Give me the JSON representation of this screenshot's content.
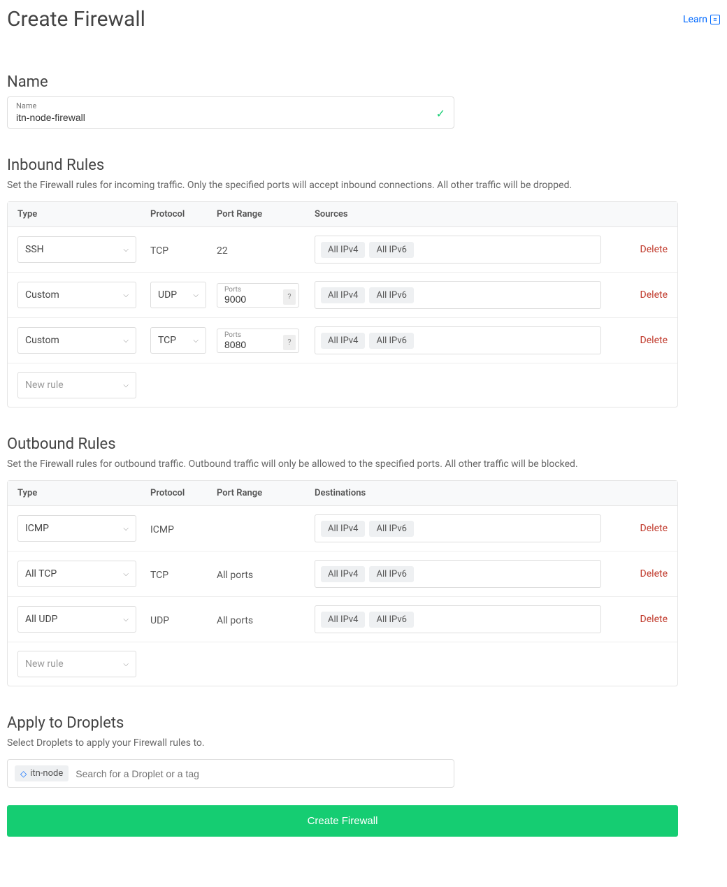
{
  "page": {
    "title": "Create Firewall",
    "learn": "Learn"
  },
  "name_section": {
    "heading": "Name",
    "label": "Name",
    "value": "itn-node-firewall"
  },
  "inbound": {
    "heading": "Inbound Rules",
    "desc": "Set the Firewall rules for incoming traffic. Only the specified ports will accept inbound connections. All other traffic will be dropped.",
    "cols": {
      "type": "Type",
      "protocol": "Protocol",
      "port": "Port Range",
      "sources": "Sources"
    },
    "port_label": "Ports",
    "help": "?",
    "rows": [
      {
        "type": "SSH",
        "protocol": "TCP",
        "protocol_editable": false,
        "port": "22",
        "port_editable": false,
        "sources": [
          "All IPv4",
          "All IPv6"
        ],
        "delete": "Delete"
      },
      {
        "type": "Custom",
        "protocol": "UDP",
        "protocol_editable": true,
        "port": "9000",
        "port_editable": true,
        "sources": [
          "All IPv4",
          "All IPv6"
        ],
        "delete": "Delete"
      },
      {
        "type": "Custom",
        "protocol": "TCP",
        "protocol_editable": true,
        "port": "8080",
        "port_editable": true,
        "sources": [
          "All IPv4",
          "All IPv6"
        ],
        "delete": "Delete"
      }
    ],
    "new_rule": "New rule"
  },
  "outbound": {
    "heading": "Outbound Rules",
    "desc": "Set the Firewall rules for outbound traffic. Outbound traffic will only be allowed to the specified ports. All other traffic will be blocked.",
    "cols": {
      "type": "Type",
      "protocol": "Protocol",
      "port": "Port Range",
      "dest": "Destinations"
    },
    "rows": [
      {
        "type": "ICMP",
        "protocol": "ICMP",
        "port": "",
        "dest": [
          "All IPv4",
          "All IPv6"
        ],
        "delete": "Delete"
      },
      {
        "type": "All TCP",
        "protocol": "TCP",
        "port": "All ports",
        "dest": [
          "All IPv4",
          "All IPv6"
        ],
        "delete": "Delete"
      },
      {
        "type": "All UDP",
        "protocol": "UDP",
        "port": "All ports",
        "dest": [
          "All IPv4",
          "All IPv6"
        ],
        "delete": "Delete"
      }
    ],
    "new_rule": "New rule"
  },
  "droplets": {
    "heading": "Apply to Droplets",
    "desc": "Select Droplets to apply your Firewall rules to.",
    "tag": "itn-node",
    "placeholder": "Search for a Droplet or a tag"
  },
  "submit": "Create Firewall"
}
